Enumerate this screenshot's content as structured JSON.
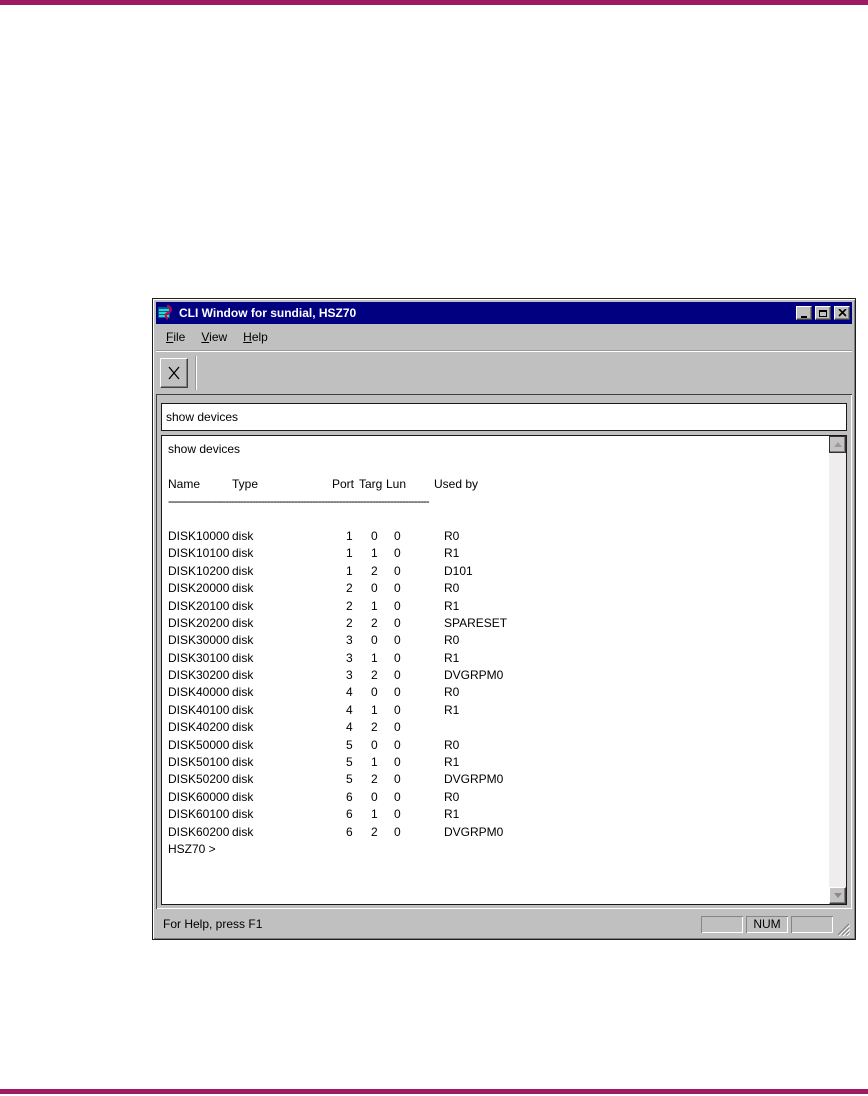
{
  "page": {
    "rule_color": "#9e1b62",
    "background": "#ffffff"
  },
  "window": {
    "title": "CLI Window for sundial, HSZ70",
    "titlebar_color": "#000080",
    "chrome_color": "#c0c0c0",
    "icons": {
      "app": "hsz70-controller-icon",
      "minimize": "minimize-icon",
      "maximize": "maximize-icon",
      "close": "close-x-icon",
      "toolbar_button": "x-icon",
      "scroll_up": "arrow-up-icon",
      "scroll_down": "arrow-down-icon",
      "resize_grip": "resize-grip-icon"
    },
    "menu": {
      "items": [
        {
          "label": "File"
        },
        {
          "label": "View"
        },
        {
          "label": "Help"
        }
      ]
    }
  },
  "terminal": {
    "command_input": "show devices",
    "echo": "show devices",
    "columns": [
      "Name",
      "Type",
      "Port",
      "Targ",
      "Lun",
      "Used by"
    ],
    "separator": "---------------------------------------------------------------------------------------",
    "rows": [
      {
        "name": "DISK10000",
        "type": "disk",
        "port": "1",
        "targ": "0",
        "lun": "0",
        "used_by": "R0"
      },
      {
        "name": "DISK10100",
        "type": "disk",
        "port": "1",
        "targ": "1",
        "lun": "0",
        "used_by": "R1"
      },
      {
        "name": "DISK10200",
        "type": "disk",
        "port": "1",
        "targ": "2",
        "lun": "0",
        "used_by": "D101"
      },
      {
        "name": "DISK20000",
        "type": "disk",
        "port": "2",
        "targ": "0",
        "lun": "0",
        "used_by": "R0"
      },
      {
        "name": "DISK20100",
        "type": "disk",
        "port": "2",
        "targ": "1",
        "lun": "0",
        "used_by": "R1"
      },
      {
        "name": "DISK20200",
        "type": "disk",
        "port": "2",
        "targ": "2",
        "lun": "0",
        "used_by": "SPARESET"
      },
      {
        "name": "DISK30000",
        "type": "disk",
        "port": "3",
        "targ": "0",
        "lun": "0",
        "used_by": "R0"
      },
      {
        "name": "DISK30100",
        "type": "disk",
        "port": "3",
        "targ": "1",
        "lun": "0",
        "used_by": "R1"
      },
      {
        "name": "DISK30200",
        "type": "disk",
        "port": "3",
        "targ": "2",
        "lun": "0",
        "used_by": "DVGRPM0"
      },
      {
        "name": "DISK40000",
        "type": "disk",
        "port": "4",
        "targ": "0",
        "lun": "0",
        "used_by": "R0"
      },
      {
        "name": "DISK40100",
        "type": "disk",
        "port": "4",
        "targ": "1",
        "lun": "0",
        "used_by": "R1"
      },
      {
        "name": "DISK40200",
        "type": "disk",
        "port": "4",
        "targ": "2",
        "lun": "0",
        "used_by": ""
      },
      {
        "name": "DISK50000",
        "type": "disk",
        "port": "5",
        "targ": "0",
        "lun": "0",
        "used_by": "R0"
      },
      {
        "name": "DISK50100",
        "type": "disk",
        "port": "5",
        "targ": "1",
        "lun": "0",
        "used_by": "R1"
      },
      {
        "name": "DISK50200",
        "type": "disk",
        "port": "5",
        "targ": "2",
        "lun": "0",
        "used_by": "DVGRPM0"
      },
      {
        "name": "DISK60000",
        "type": "disk",
        "port": "6",
        "targ": "0",
        "lun": "0",
        "used_by": "R0"
      },
      {
        "name": "DISK60100",
        "type": "disk",
        "port": "6",
        "targ": "1",
        "lun": "0",
        "used_by": "R1"
      },
      {
        "name": "DISK60200",
        "type": "disk",
        "port": "6",
        "targ": "2",
        "lun": "0",
        "used_by": "DVGRPM0"
      }
    ],
    "prompt": "HSZ70 >"
  },
  "status_bar": {
    "message": "For Help, press F1",
    "indicators": [
      "",
      "NUM",
      ""
    ]
  }
}
